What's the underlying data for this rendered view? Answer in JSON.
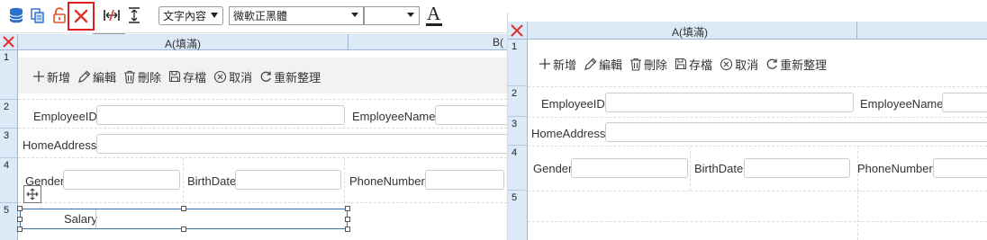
{
  "toolbar": {
    "icons": [
      "database-icon",
      "copy-icon",
      "unlock-icon",
      "delete-icon",
      "column-width-icon",
      "row-height-icon"
    ],
    "tooltip": "刪除",
    "content_select": "文字內容",
    "font_select": "微軟正黑體",
    "size_select": "",
    "font_icon": "A"
  },
  "left_sheet": {
    "col_a": "A(填滿)",
    "col_b": "B(",
    "rows": [
      "1",
      "2",
      "3",
      "4",
      "5"
    ]
  },
  "right_sheet": {
    "col_a": "A(填滿)",
    "rows": [
      "1",
      "2",
      "3",
      "4",
      "5"
    ]
  },
  "actions": {
    "add": "新增",
    "edit": "編輯",
    "delete": "刪除",
    "save": "存檔",
    "cancel": "取消",
    "refresh": "重新整理"
  },
  "fields": {
    "employee_id": "EmployeeID",
    "employee_name": "EmployeeName",
    "home_address": "HomeAddress",
    "gender": "Gender",
    "birth_date": "BirthDate",
    "phone_number": "PhoneNumber",
    "salary": "Salary"
  },
  "colors": {
    "header_bg": "#dce9f7",
    "delete_red": "#e0312b",
    "selection_border": "#3b6fb6",
    "highlight_box": "#e02020"
  }
}
